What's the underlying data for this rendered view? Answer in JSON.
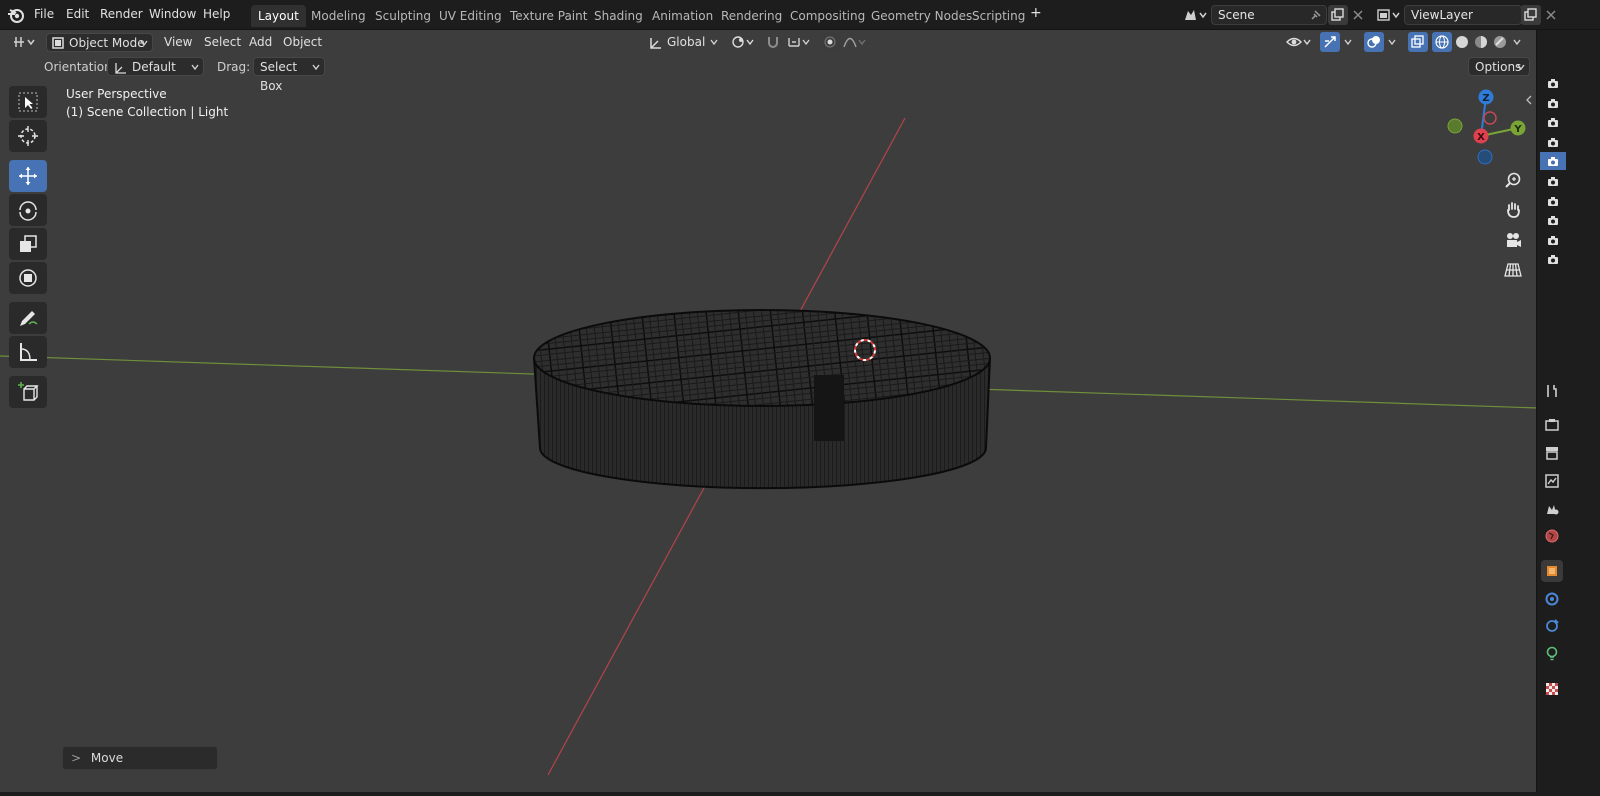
{
  "menu": {
    "items": [
      "File",
      "Edit",
      "Render",
      "Window",
      "Help"
    ]
  },
  "workspaces": {
    "tabs": [
      "Layout",
      "Modeling",
      "Sculpting",
      "UV Editing",
      "Texture Paint",
      "Shading",
      "Animation",
      "Rendering",
      "Compositing",
      "Geometry Nodes",
      "Scripting"
    ],
    "active": "Layout",
    "add_symbol": "+"
  },
  "scene": {
    "name": "Scene"
  },
  "view_layer": {
    "name": "ViewLayer"
  },
  "header": {
    "mode": "Object Mode",
    "menus": [
      "View",
      "Select",
      "Add",
      "Object"
    ],
    "transform_orientation": "Global",
    "options_label": "Options"
  },
  "tool_settings": {
    "orientation_label": "Orientation:",
    "orientation_value": "Default",
    "drag_label": "Drag:",
    "drag_value": "Select Box"
  },
  "viewport": {
    "view_name": "User Perspective",
    "collection_info": "(1) Scene Collection | Light"
  },
  "gizmo": {
    "z": "Z",
    "y": "Y",
    "x": "X"
  },
  "last_operator": {
    "label": "Move",
    "chevron": ">"
  },
  "colors": {
    "accent": "#4772b3",
    "viewport_bg": "#3d3d3d",
    "x_axis": "#c04a55",
    "y_axis": "#7aa535",
    "z_axis": "#2f7bd8"
  }
}
